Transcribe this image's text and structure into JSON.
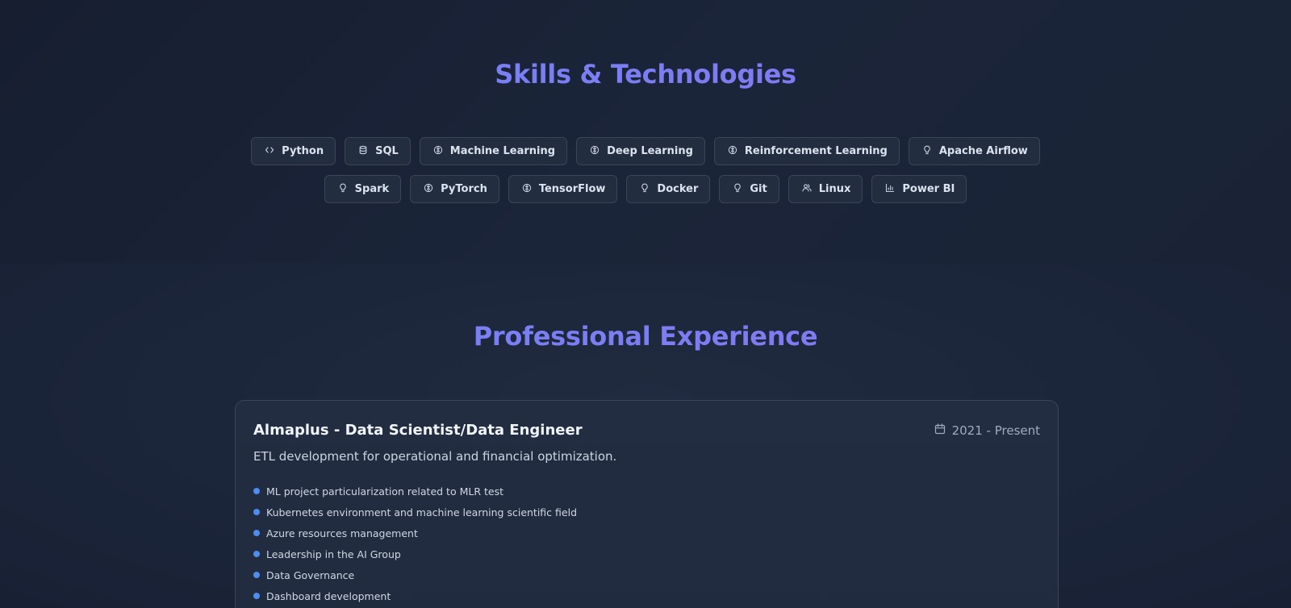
{
  "skills": {
    "title": "Skills & Technologies",
    "items": [
      {
        "label": "Python",
        "icon": "code-icon"
      },
      {
        "label": "SQL",
        "icon": "database-icon"
      },
      {
        "label": "Machine Learning",
        "icon": "brain-icon"
      },
      {
        "label": "Deep Learning",
        "icon": "brain-icon"
      },
      {
        "label": "Reinforcement Learning",
        "icon": "brain-icon"
      },
      {
        "label": "Apache Airflow",
        "icon": "lightbulb-icon"
      },
      {
        "label": "Spark",
        "icon": "lightbulb-icon"
      },
      {
        "label": "PyTorch",
        "icon": "brain-icon"
      },
      {
        "label": "TensorFlow",
        "icon": "brain-icon"
      },
      {
        "label": "Docker",
        "icon": "lightbulb-icon"
      },
      {
        "label": "Git",
        "icon": "lightbulb-icon"
      },
      {
        "label": "Linux",
        "icon": "users-icon"
      },
      {
        "label": "Power BI",
        "icon": "bar-chart-icon"
      }
    ]
  },
  "experience": {
    "title": "Professional Experience",
    "jobs": [
      {
        "role": "Almaplus - Data Scientist/Data Engineer",
        "period": "2021 - Present",
        "description": "ETL development for operational and financial optimization.",
        "highlights": [
          "ML project particularization related to MLR test",
          "Kubernetes environment and machine learning scientific field",
          "Azure resources management",
          "Leadership in the AI Group",
          "Data Governance",
          "Dashboard development"
        ]
      }
    ]
  },
  "colors": {
    "title_gradient_start": "#6f86f5",
    "title_gradient_end": "#8b74f0",
    "bullet": "#4e8df0",
    "chip_border": "#3b4559",
    "background": "#1a2234"
  }
}
